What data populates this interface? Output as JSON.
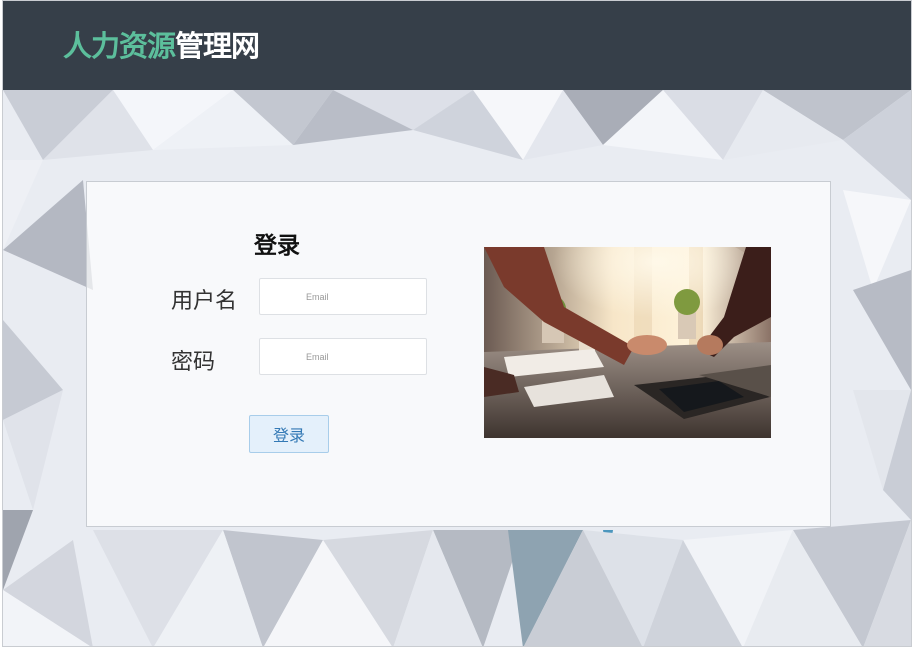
{
  "header": {
    "brand_accent": "人力资源",
    "brand_rest": "管理网",
    "accent_color": "#5cbf9c",
    "background_color": "#363f49"
  },
  "login": {
    "title": "登录",
    "username_label": "用户名",
    "username_placeholder": "Email",
    "password_label": "密码",
    "password_placeholder": "Email",
    "submit_label": "登录"
  },
  "illustration": {
    "icon": "office-meeting-photo"
  }
}
